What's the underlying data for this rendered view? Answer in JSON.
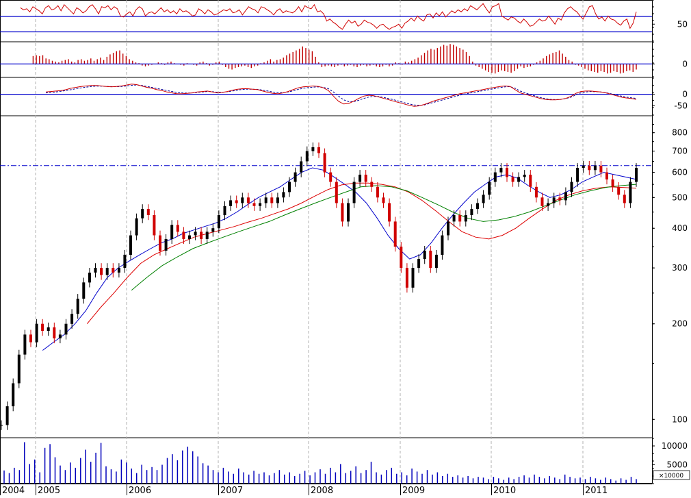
{
  "chart_data": [
    {
      "panel": "rsi",
      "type": "line",
      "y_ticks": [
        {
          "v": 50,
          "label": "50"
        }
      ],
      "ref_lines": [
        65,
        35
      ],
      "ylim": [
        17,
        97
      ],
      "colors": {
        "line": "#d00000",
        "ref": "#0000cc"
      },
      "series": [
        {
          "values": [
            82,
            78,
            80,
            74,
            84,
            80,
            76,
            70,
            82,
            86,
            78,
            80,
            86,
            76,
            88,
            82,
            76,
            70,
            82,
            78,
            72,
            76,
            84,
            88,
            80,
            70,
            84,
            82,
            86,
            78,
            84,
            80,
            66,
            64,
            70,
            74,
            66,
            78,
            84,
            80,
            66,
            72,
            74,
            70,
            76,
            82,
            74,
            78,
            72,
            76,
            70,
            80,
            74,
            76,
            72,
            66,
            68,
            80,
            76,
            70,
            78,
            74,
            68,
            70,
            74,
            78,
            76,
            80,
            72,
            74,
            78,
            68,
            76,
            84,
            80,
            78,
            72,
            84,
            82,
            78,
            74,
            68,
            76,
            80,
            72,
            76,
            74,
            72,
            76,
            84,
            74,
            86,
            82,
            80,
            88,
            74,
            76,
            70,
            56,
            60,
            54,
            50,
            44,
            40,
            50,
            58,
            52,
            56,
            46,
            50,
            58,
            54,
            52,
            48,
            42,
            48,
            50,
            44,
            40,
            44,
            46,
            50,
            42,
            52,
            56,
            62,
            56,
            66,
            60,
            56,
            68,
            70,
            62,
            72,
            66,
            74,
            64,
            70,
            76,
            72,
            78,
            74,
            80,
            76,
            86,
            82,
            78,
            84,
            90,
            80,
            72,
            84,
            86,
            90,
            66,
            62,
            58,
            64,
            62,
            56,
            52,
            60,
            54,
            46,
            48,
            54,
            60,
            56,
            58,
            66,
            58,
            50,
            62,
            58,
            72,
            80,
            84,
            78,
            74,
            66,
            60,
            72,
            84,
            86,
            70,
            60,
            64,
            56,
            66,
            60,
            58,
            52,
            48,
            56,
            60,
            42,
            52,
            74
          ]
        }
      ]
    },
    {
      "panel": "momentum",
      "type": "bar",
      "y_ticks": [
        {
          "v": 0,
          "label": "0"
        }
      ],
      "ref_lines": [
        0
      ],
      "ylim": [
        -16,
        27
      ],
      "colors": {
        "bar": "#c00000",
        "ref": "#0000cc"
      },
      "values": [
        10,
        11,
        10,
        11,
        7,
        6,
        4,
        3,
        2,
        4,
        5,
        6,
        3,
        2,
        5,
        6,
        4,
        5,
        7,
        4,
        6,
        8,
        5,
        9,
        12,
        14,
        16,
        17,
        13,
        10,
        6,
        4,
        2,
        1,
        -2,
        -3,
        -2,
        -1,
        0,
        2,
        1,
        -1,
        2,
        3,
        1,
        0,
        -1,
        -2,
        1,
        0,
        -1,
        -2,
        2,
        3,
        1,
        -2,
        -1,
        2,
        3,
        -1,
        -4,
        -6,
        -7,
        -5,
        -4,
        -3,
        -2,
        -4,
        -5,
        -3,
        -2,
        1,
        2,
        4,
        6,
        3,
        5,
        6,
        8,
        11,
        13,
        15,
        17,
        19,
        22,
        20,
        18,
        16,
        9,
        2,
        -4,
        -3,
        -2,
        -3,
        -4,
        -2,
        -1,
        -3,
        -2,
        -1,
        -3,
        -4,
        -2,
        -1,
        -3,
        -2,
        -1,
        -3,
        -4,
        -3,
        -1,
        -3,
        -2,
        2,
        1,
        -1,
        3,
        2,
        4,
        6,
        8,
        11,
        14,
        17,
        19,
        18,
        20,
        22,
        24,
        23,
        25,
        24,
        22,
        20,
        18,
        15,
        10,
        3,
        -2,
        -4,
        -6,
        -8,
        -10,
        -11,
        -12,
        -10,
        -8,
        -9,
        -10,
        -11,
        -9,
        -6,
        -3,
        -5,
        -4,
        -3,
        -1,
        2,
        4,
        7,
        10,
        12,
        14,
        15,
        17,
        13,
        9,
        5,
        3,
        -1,
        -2,
        -4,
        -6,
        -8,
        -9,
        -10,
        -11,
        -9,
        -10,
        -12,
        -11,
        -9,
        -10,
        -12,
        -11,
        -9,
        -8,
        -10,
        -7
      ]
    },
    {
      "panel": "oscillator",
      "type": "line",
      "y_ticks": [
        {
          "v": 0,
          "label": "0"
        },
        {
          "v": -50,
          "label": "-50"
        }
      ],
      "ref_lines": [
        0
      ],
      "ylim": [
        -90,
        70
      ],
      "colors": {
        "main": "#d00000",
        "signal": "#000099",
        "ref": "#0000cc"
      },
      "series": [
        {
          "values": [
            10,
            12,
            14,
            16,
            20,
            26,
            30,
            34,
            36,
            38,
            38,
            36,
            34,
            32,
            34,
            36,
            40,
            44,
            42,
            36,
            30,
            26,
            20,
            16,
            10,
            6,
            2,
            2,
            4,
            6,
            10,
            12,
            14,
            10,
            6,
            8,
            12,
            18,
            22,
            24,
            24,
            22,
            20,
            14,
            8,
            4,
            2,
            6,
            12,
            20,
            28,
            32,
            34,
            36,
            34,
            28,
            16,
            -8,
            -30,
            -42,
            -40,
            -30,
            -18,
            -8,
            -4,
            -6,
            -12,
            -18,
            -24,
            -30,
            -36,
            -42,
            -48,
            -52,
            -50,
            -44,
            -36,
            -28,
            -22,
            -16,
            -10,
            -4,
            2,
            6,
            10,
            14,
            18,
            22,
            26,
            30,
            34,
            36,
            34,
            20,
            6,
            0,
            -6,
            -12,
            -18,
            -22,
            -24,
            -24,
            -22,
            -18,
            -10,
            4,
            12,
            14,
            14,
            12,
            10,
            6,
            0,
            -6,
            -12,
            -16,
            -18,
            -22
          ]
        },
        {
          "values": [
            6,
            8,
            10,
            13,
            16,
            20,
            24,
            28,
            31,
            34,
            35,
            35,
            34,
            33,
            33,
            34,
            36,
            39,
            40,
            38,
            34,
            30,
            25,
            21,
            16,
            12,
            8,
            6,
            5,
            6,
            8,
            10,
            12,
            11,
            9,
            9,
            11,
            14,
            18,
            21,
            22,
            22,
            21,
            18,
            14,
            10,
            7,
            7,
            10,
            15,
            21,
            26,
            29,
            31,
            32,
            30,
            24,
            10,
            -8,
            -24,
            -32,
            -32,
            -26,
            -18,
            -12,
            -9,
            -10,
            -14,
            -19,
            -24,
            -30,
            -36,
            -42,
            -46,
            -48,
            -46,
            -40,
            -34,
            -28,
            -22,
            -16,
            -10,
            -4,
            1,
            5,
            9,
            13,
            17,
            21,
            25,
            29,
            32,
            33,
            26,
            14,
            6,
            -1,
            -8,
            -14,
            -19,
            -22,
            -23,
            -22,
            -19,
            -13,
            -3,
            6,
            10,
            12,
            11,
            10,
            7,
            2,
            -3,
            -8,
            -12,
            -15,
            -18
          ]
        }
      ]
    },
    {
      "panel": "price",
      "type": "line",
      "scale": "log",
      "ylim": [
        88,
        900
      ],
      "y_ticks": [
        {
          "v": 800,
          "label": "800"
        },
        {
          "v": 700,
          "label": "700"
        },
        {
          "v": 600,
          "label": "600"
        },
        {
          "v": 500,
          "label": "500"
        },
        {
          "v": 400,
          "label": "400"
        },
        {
          "v": 300,
          "label": "300"
        },
        {
          "v": 200,
          "label": "200"
        },
        {
          "v": 100,
          "label": "100"
        }
      ],
      "resistance_level": 630,
      "colors": {
        "price": "#000000",
        "down": "#d00000",
        "ma_short": "#0000cc",
        "ma_mid": "#dd0000",
        "ma_long": "#008000",
        "resistance": "#0000cc"
      },
      "series": [
        {
          "name": "",
          "role": "price",
          "values": [
            96,
            110,
            130,
            160,
            185,
            175,
            200,
            190,
            195,
            180,
            185,
            200,
            215,
            240,
            270,
            290,
            300,
            285,
            300,
            290,
            300,
            330,
            380,
            430,
            460,
            440,
            380,
            340,
            370,
            410,
            390,
            370,
            380,
            390,
            370,
            390,
            400,
            440,
            470,
            490,
            480,
            500,
            480,
            470,
            480,
            500,
            480,
            500,
            520,
            560,
            600,
            650,
            700,
            720,
            690,
            600,
            560,
            480,
            420,
            480,
            560,
            590,
            560,
            540,
            500,
            480,
            420,
            350,
            300,
            260,
            300,
            320,
            340,
            300,
            330,
            380,
            420,
            440,
            420,
            440,
            460,
            480,
            510,
            560,
            600,
            620,
            580,
            560,
            580,
            590,
            540,
            500,
            470,
            480,
            500,
            490,
            520,
            560,
            620,
            630,
            610,
            630,
            600,
            570,
            540,
            510,
            480,
            560,
            620
          ]
        },
        {
          "name": "",
          "role": "ma_short",
          "values": [
            165,
            175,
            185,
            200,
            220,
            250,
            280,
            300,
            315,
            330,
            345,
            360,
            370,
            385,
            395,
            405,
            415,
            430,
            450,
            475,
            500,
            520,
            540,
            570,
            600,
            620,
            610,
            580,
            550,
            520,
            480,
            430,
            380,
            345,
            320,
            330,
            360,
            400,
            440,
            480,
            520,
            550,
            580,
            590,
            575,
            545,
            520,
            500,
            510,
            530,
            560,
            580,
            600,
            590,
            580,
            570
          ]
        },
        {
          "name": "",
          "role": "ma_mid",
          "values": [
            200,
            225,
            250,
            280,
            310,
            330,
            345,
            360,
            375,
            385,
            395,
            405,
            418,
            430,
            445,
            460,
            480,
            505,
            530,
            548,
            555,
            555,
            550,
            540,
            520,
            490,
            455,
            420,
            390,
            375,
            370,
            380,
            400,
            430,
            460,
            490,
            510,
            525,
            535,
            540,
            538,
            535
          ]
        },
        {
          "name": "",
          "role": "ma_long",
          "values": [
            255,
            280,
            305,
            325,
            345,
            360,
            375,
            390,
            405,
            420,
            440,
            460,
            480,
            500,
            520,
            540,
            545,
            540,
            525,
            500,
            475,
            450,
            430,
            420,
            425,
            435,
            450,
            470,
            490,
            510,
            525,
            538,
            545,
            550
          ]
        }
      ]
    },
    {
      "panel": "volume",
      "type": "bar",
      "y_ticks": [
        {
          "v": 10000,
          "label": "10000"
        },
        {
          "v": 5000,
          "label": "5000"
        }
      ],
      "ylim": [
        0,
        12000
      ],
      "unit_label": "×10000",
      "colors": {
        "bar": "#0000bb"
      },
      "values": [
        3500,
        2800,
        4200,
        3600,
        11000,
        5200,
        6400,
        3000,
        9500,
        10500,
        7000,
        4800,
        3600,
        5600,
        4200,
        6800,
        9000,
        5800,
        8200,
        10800,
        4600,
        3800,
        3200,
        6400,
        5600,
        4000,
        2800,
        5000,
        3600,
        4400,
        3600,
        5000,
        6800,
        7800,
        6200,
        8800,
        9800,
        8600,
        7200,
        5400,
        4800,
        3600,
        3000,
        4200,
        3200,
        2600,
        4000,
        3000,
        2400,
        3400,
        2600,
        3000,
        2200,
        2800,
        3600,
        2400,
        3000,
        2000,
        2600,
        3400,
        2200,
        3000,
        3800,
        2600,
        4200,
        3000,
        5200,
        2800,
        3400,
        4600,
        2800,
        3600,
        5800,
        3000,
        2400,
        3600,
        4200,
        2600,
        3000,
        2200,
        4000,
        3200,
        2600,
        3600,
        2400,
        3000,
        2000,
        2600,
        1800,
        2200,
        1600,
        2000,
        1400,
        1800,
        1600,
        1200,
        1800,
        1400,
        1000,
        1600,
        1200,
        1800,
        2200,
        1600,
        2400,
        1800,
        1400,
        2000,
        1600,
        1200,
        2400,
        1800,
        1400,
        1600,
        1200,
        1800,
        1400,
        1000,
        1600,
        1200,
        800,
        1400,
        1000,
        1800,
        1200
      ]
    }
  ],
  "x_axis": {
    "labels": [
      "2004",
      "2005",
      "2006",
      "2007",
      "2008",
      "2009",
      "2010",
      "2011"
    ]
  }
}
